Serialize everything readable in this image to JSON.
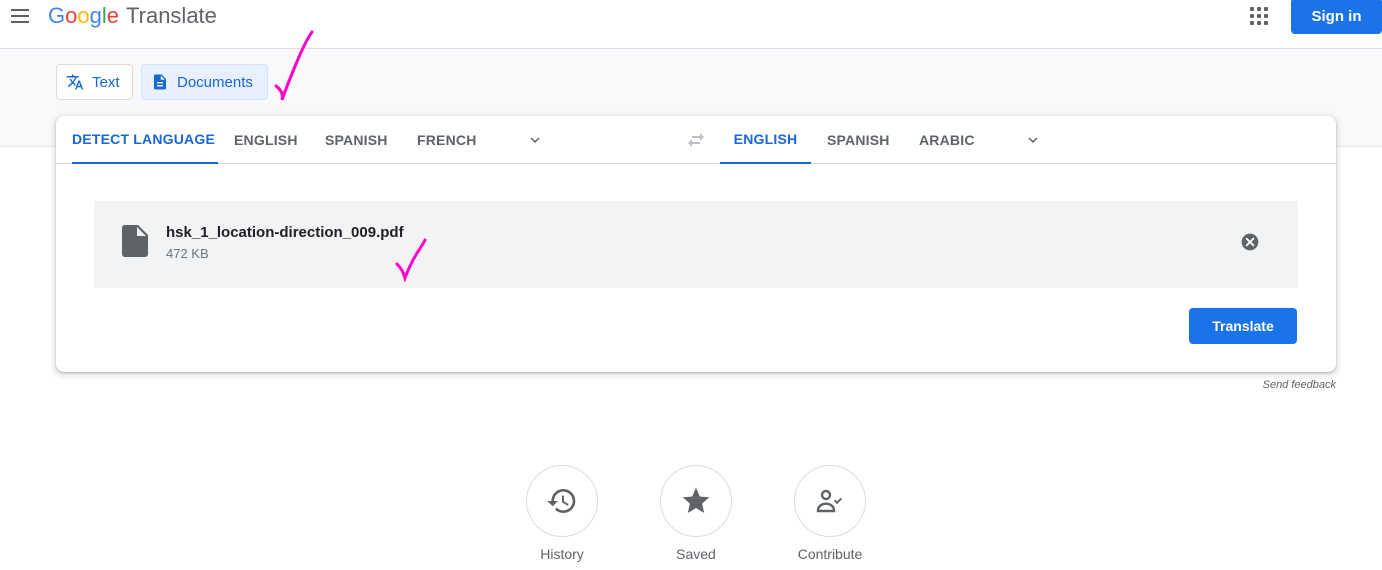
{
  "header": {
    "logo_google": "Google",
    "logo_product": "Translate",
    "signin_label": "Sign in"
  },
  "modes": {
    "text_label": "Text",
    "documents_label": "Documents",
    "active": "Documents"
  },
  "source_languages": {
    "tabs": [
      "DETECT LANGUAGE",
      "ENGLISH",
      "SPANISH",
      "FRENCH"
    ],
    "active": "DETECT LANGUAGE"
  },
  "target_languages": {
    "tabs": [
      "ENGLISH",
      "SPANISH",
      "ARABIC"
    ],
    "active": "ENGLISH"
  },
  "file": {
    "name": "hsk_1_location-direction_009.pdf",
    "size": "472 KB"
  },
  "translate_label": "Translate",
  "feedback_label": "Send feedback",
  "actions": [
    {
      "label": "History",
      "icon": "history-icon"
    },
    {
      "label": "Saved",
      "icon": "star-icon"
    },
    {
      "label": "Contribute",
      "icon": "contribute-icon"
    }
  ],
  "colors": {
    "accent": "#1a73e8",
    "active_text": "#1967d2",
    "annotation": "#ff00cc"
  }
}
